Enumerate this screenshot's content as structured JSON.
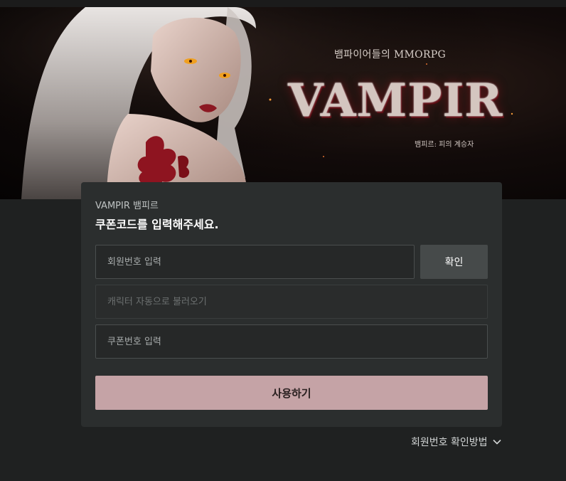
{
  "banner": {
    "tagline": "뱀파이어들의 MMORPG",
    "logo_text": "VAMPIR",
    "logo_subtitle": "뱀피르: 피의 계승자"
  },
  "card": {
    "subtitle": "VAMPIR 뱀피르",
    "title": "쿠폰코드를 입력해주세요.",
    "member_input": {
      "value": "",
      "placeholder": "회원번호 입력"
    },
    "confirm_label": "확인",
    "character_input": {
      "value": "",
      "placeholder": "캐릭터 자동으로 불러오기"
    },
    "coupon_input": {
      "value": "",
      "placeholder": "쿠폰번호 입력"
    },
    "submit_label": "사용하기"
  },
  "help": {
    "label": "회원번호 확인방법",
    "icon": "chevron-down-icon"
  },
  "colors": {
    "page_bg": "#1f2121",
    "card_bg": "#2b2e2e",
    "submit_bg": "#c5a3a6",
    "confirm_bg": "#464a4a"
  }
}
